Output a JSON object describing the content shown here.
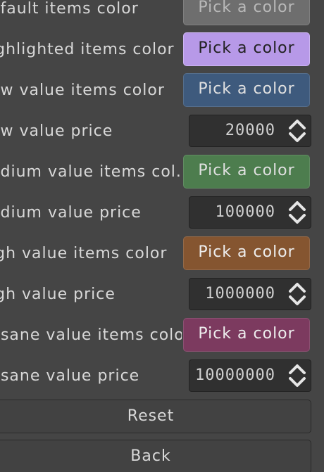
{
  "settings": [
    {
      "kind": "color",
      "label": "efault items color",
      "button": "Pick a color",
      "color": "#6e6e6e",
      "text_color": "#b9b9b9"
    },
    {
      "kind": "color",
      "label": "ighlighted items color",
      "button": "Pick a color",
      "color": "#b799e8",
      "text_color": "#222222"
    },
    {
      "kind": "color",
      "label": "ow value items color",
      "button": "Pick a color",
      "color": "#3e5a7d",
      "text_color": "#e0e0e0"
    },
    {
      "kind": "number",
      "label": "ow value price",
      "value": "20000"
    },
    {
      "kind": "color",
      "label": "edium value items col...",
      "button": "Pick a color",
      "color": "#4d7d4e",
      "text_color": "#e0e0e0"
    },
    {
      "kind": "number",
      "label": "edium value price",
      "value": "100000"
    },
    {
      "kind": "color",
      "label": "igh value items color",
      "button": "Pick a color",
      "color": "#855530",
      "text_color": "#eeeeee"
    },
    {
      "kind": "number",
      "label": "igh value price",
      "value": "1000000"
    },
    {
      "kind": "color",
      "label": "nsane value items color",
      "button": "Pick a color",
      "color": "#7c3a5f",
      "text_color": "#eeeeee"
    },
    {
      "kind": "number",
      "label": "nsane value price",
      "value": "10000000"
    }
  ],
  "buttons": {
    "reset": "Reset",
    "back": "Back"
  }
}
